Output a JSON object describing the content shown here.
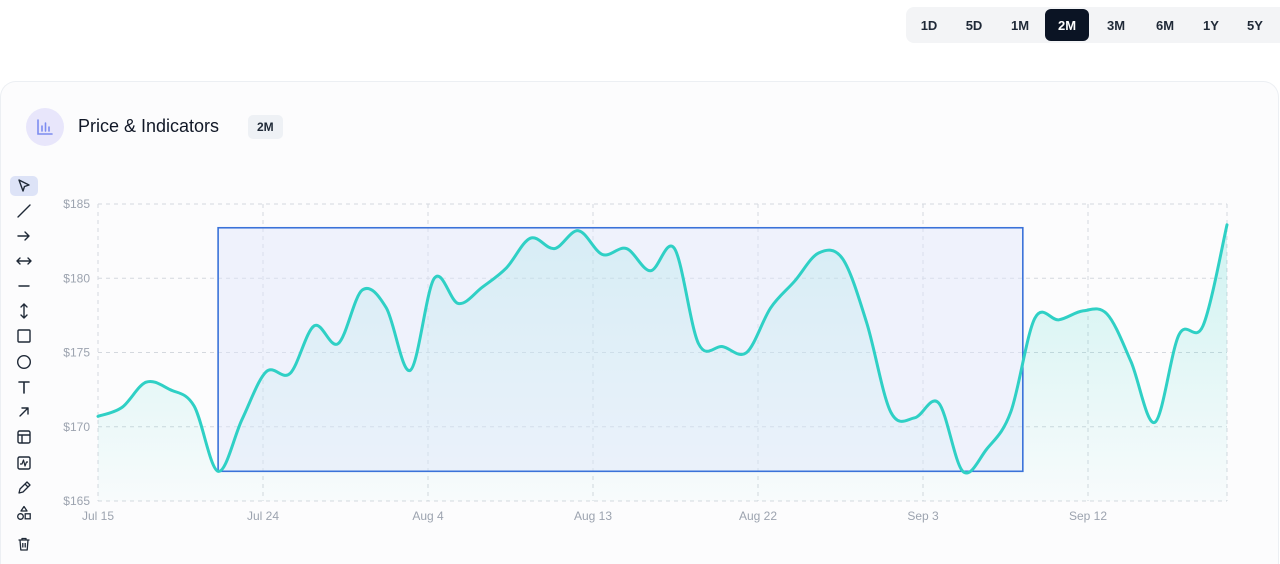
{
  "range_selector": {
    "options": [
      "1D",
      "5D",
      "1M",
      "2M",
      "3M",
      "6M",
      "1Y",
      "5Y"
    ],
    "active": "2M"
  },
  "panel": {
    "title": "Price & Indicators",
    "badge": "2M",
    "icon": "bar-chart-icon"
  },
  "toolbar": {
    "tools": [
      "cursor-icon",
      "trendline-icon",
      "arrow-icon",
      "range-arrow-icon",
      "horizontal-line-icon",
      "vertical-range-icon",
      "rectangle-icon",
      "circle-icon",
      "text-icon",
      "diagonal-arrow-icon",
      "layout-icon",
      "indicator-icon",
      "pen-icon",
      "shapes-icon",
      "trash-icon"
    ],
    "active": "cursor-icon"
  },
  "colors": {
    "line": "#2fd0c5",
    "selection_stroke": "#3a72d9",
    "selection_fill": "#dfe6fb",
    "active_button": "#0b1424"
  },
  "chart_data": {
    "type": "area",
    "title": "",
    "xlabel": "",
    "ylabel": "",
    "x_ticks": [
      "Jul 15",
      "Jul 24",
      "Aug 4",
      "Aug 13",
      "Aug 22",
      "Sep 3",
      "Sep 12"
    ],
    "y_ticks": [
      "$165",
      "$170",
      "$175",
      "$180",
      "$185"
    ],
    "ylim": [
      165,
      185
    ],
    "grid": true,
    "series": [
      {
        "values": [
          170.7,
          171.3,
          173.0,
          172.5,
          171.4,
          167.0,
          170.5,
          173.7,
          173.6,
          176.8,
          175.6,
          179.2,
          178.0,
          173.8,
          180.0,
          178.3,
          179.4,
          180.7,
          182.7,
          182.0,
          183.2,
          181.6,
          182.0,
          180.5,
          182.0,
          175.6,
          175.4,
          175.0,
          178.0,
          179.8,
          181.7,
          181.3,
          177.0,
          171.0,
          170.6,
          171.6,
          167.0,
          168.5,
          171.0,
          177.3,
          177.2,
          177.8,
          177.6,
          174.4,
          170.3,
          176.2,
          176.8,
          183.6
        ]
      }
    ],
    "annotations": [
      {
        "type": "rectangle",
        "x_start_index": 5,
        "x_end_index": 38.5,
        "y_low": 167.0,
        "y_high": 183.4
      }
    ]
  }
}
